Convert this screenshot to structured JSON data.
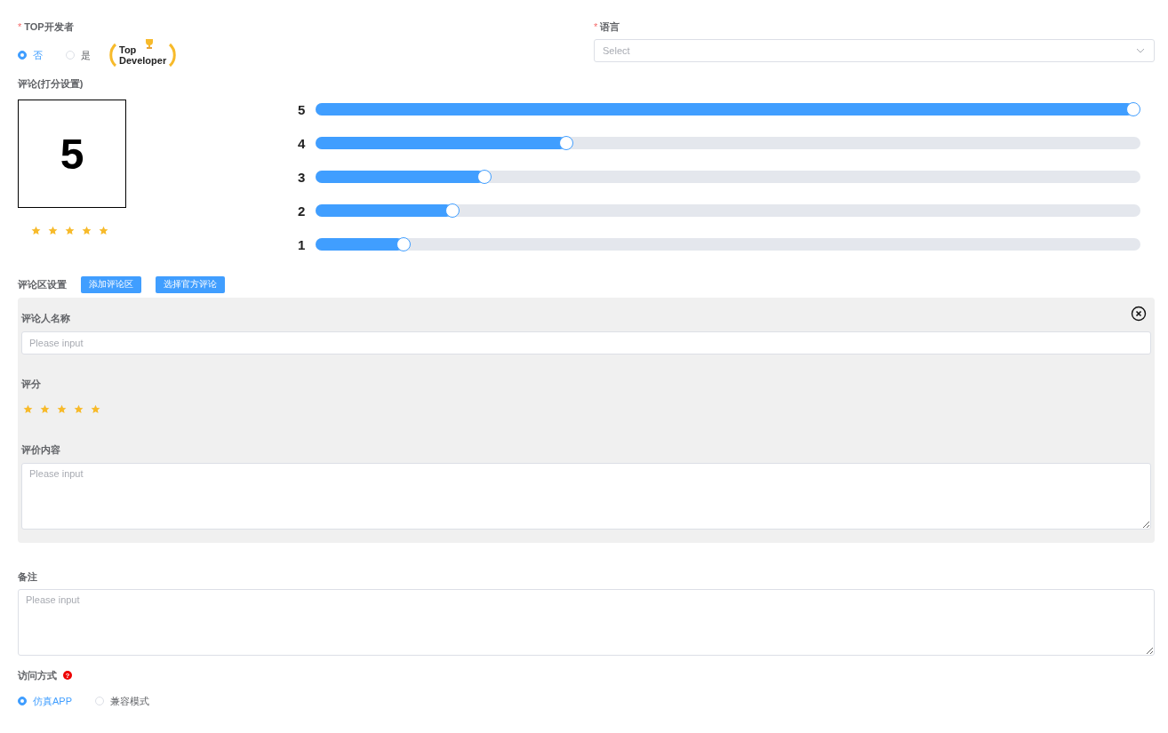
{
  "top_developer": {
    "marker": "*",
    "label": "TOP开发者",
    "options": [
      {
        "label": "否",
        "selected": true
      },
      {
        "label": "是",
        "selected": false
      }
    ],
    "badge": {
      "line_1": "Top",
      "line_2": "Developer"
    }
  },
  "language": {
    "marker": "*",
    "label": "语言",
    "placeholder": "Select"
  },
  "rating": {
    "label": "评论(打分设置)",
    "score": "5",
    "stars": 5,
    "bars": [
      {
        "label": "5",
        "level": 1.0
      },
      {
        "label": "4",
        "level": 0.3
      },
      {
        "label": "3",
        "level": 0.2
      },
      {
        "label": "2",
        "level": 0.16
      },
      {
        "label": "1",
        "level": 0.1
      }
    ]
  },
  "comment_section": {
    "label": "评论区设置",
    "buttons": [
      "添加评论区",
      "选择官方评论"
    ],
    "card": {
      "fields": [
        {
          "kind": "input",
          "label": "评论人名称",
          "placeholder": "Please input"
        },
        {
          "kind": "stars",
          "label": "评分",
          "stars": 5
        },
        {
          "kind": "textarea",
          "label": "评价内容",
          "placeholder": "Please input"
        }
      ]
    }
  },
  "remark": {
    "label": "备注",
    "placeholder": "Please input"
  },
  "access_mode": {
    "label": "访问方式",
    "help_icon": "?",
    "options": [
      {
        "label": "仿真APP",
        "selected": true
      },
      {
        "label": "兼容模式",
        "selected": false
      }
    ]
  }
}
